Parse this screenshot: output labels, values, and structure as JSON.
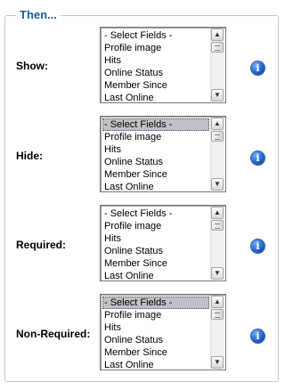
{
  "section": {
    "legend": "Then..."
  },
  "rows": [
    {
      "label": "Show:",
      "options": [
        "- Select Fields -",
        "Profile image",
        "Hits",
        "Online Status",
        "Member Since",
        "Last Online"
      ],
      "selected_index": -1
    },
    {
      "label": "Hide:",
      "options": [
        "- Select Fields -",
        "Profile image",
        "Hits",
        "Online Status",
        "Member Since",
        "Last Online"
      ],
      "selected_index": 0
    },
    {
      "label": "Required:",
      "options": [
        "- Select Fields -",
        "Profile image",
        "Hits",
        "Online Status",
        "Member Since",
        "Last Online"
      ],
      "selected_index": -1
    },
    {
      "label": "Non-Required:",
      "options": [
        "- Select Fields -",
        "Profile image",
        "Hits",
        "Online Status",
        "Member Since",
        "Last Online"
      ],
      "selected_index": 0
    }
  ],
  "icons": {
    "info": "info-icon",
    "scroll_up": "scroll-up-arrow-icon",
    "scroll_down": "scroll-down-arrow-icon"
  },
  "colors": {
    "legend": "#1d5c97",
    "selected_option": "#c0c0c8",
    "info_icon": "#1a5dc8"
  }
}
